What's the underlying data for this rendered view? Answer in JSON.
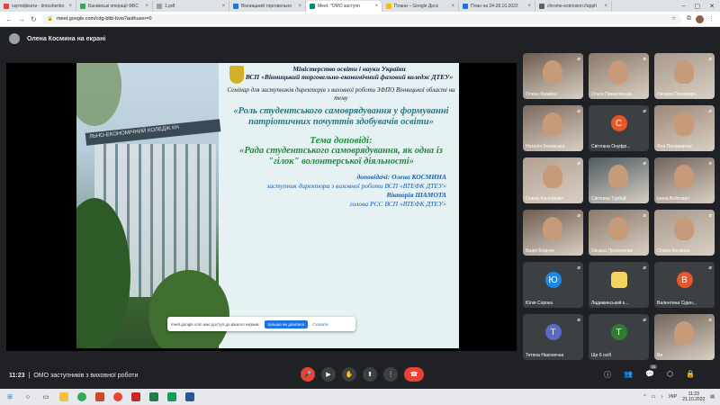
{
  "browser": {
    "tabs": [
      {
        "label": "сертифікати - timoshenko",
        "color": "#ea4335",
        "active": false
      },
      {
        "label": "Банківські операції ФБС",
        "color": "#34a853",
        "active": false
      },
      {
        "label": "1.pdf",
        "color": "#9aa0a6",
        "active": false
      },
      {
        "label": "Вінницький торговельно",
        "color": "#1a73e8",
        "active": false
      },
      {
        "label": "Meet: \"ОМО заступн",
        "color": "#00897b",
        "active": true
      },
      {
        "label": "Плани – Google Диск",
        "color": "#fbbc04",
        "active": false
      },
      {
        "label": "План на 24-28.10.2022",
        "color": "#1a73e8",
        "active": false
      },
      {
        "label": "chrome-extension://apph",
        "color": "#5f6368",
        "active": false
      }
    ],
    "url": "meet.google.com/cdg-btib-bvw?authuser=0",
    "icons": [
      "back-arrow-icon",
      "forward-arrow-icon",
      "reload-icon",
      "lock-icon",
      "star-icon",
      "extensions-icon",
      "menu-icon"
    ]
  },
  "presenter": {
    "label": "Олена Космина на екрані"
  },
  "slide": {
    "building_sign": "ЛЬНО-ЕКОНОМІЧНИЙ КОЛЕДЖ КН",
    "ministry": "Міністерство освіти і науки України",
    "college": "ВСП «Вінницький торговельно-економічний фаховий коледж ДТЕУ»",
    "seminar": "Семінар для заступників директорів з виховної роботи ЗФПО Вінницької області на тему",
    "role_title": "«Роль студентського самоврядування у формуванні патріотичних почуттів здобувачів освіти»",
    "topic_heading": "Тема доповіді:",
    "topic": "«Рада студентського самоврядування, як одна із \"гілок\" волонтерської діяльності»",
    "speakers_label": "доповідачі: Олена КОСМИНА",
    "speaker1_role": "заступник директора з виховної роботи ВСП «ВТЕФК ДТЕУ»",
    "speaker2_name": "Вікторія ШАМОТА",
    "speaker2_role": "голова РСС ВСП «ВТЕФК ДТЕУ»"
  },
  "share_notice": {
    "text": "meet.google.com має доступ до вашого екрана.",
    "stop_button": "Більше не ділитися",
    "hide_button": "Сховати"
  },
  "participants": [
    {
      "name": "Олена Кваміна",
      "type": "video"
    },
    {
      "name": "Ольга Пиньковська",
      "type": "video"
    },
    {
      "name": "Наталія Паламарч...",
      "type": "video"
    },
    {
      "name": "Наталія Возовська",
      "type": "video"
    },
    {
      "name": "Світлана Онуфрі...",
      "type": "letter",
      "letter": "С",
      "color": "#e8572a"
    },
    {
      "name": "Яна Паламарчук",
      "type": "video"
    },
    {
      "name": "Олена Косперевіч",
      "type": "video"
    },
    {
      "name": "Світлана Турбай",
      "type": "video"
    },
    {
      "name": "Ірина Войтович",
      "type": "video"
    },
    {
      "name": "Вадія Блідчук",
      "type": "video"
    },
    {
      "name": "Оксана Прокопенко",
      "type": "video"
    },
    {
      "name": "Олена Космина",
      "type": "video"
    },
    {
      "name": "Юлія Сорока",
      "type": "letter",
      "letter": "Ю",
      "color": "#1e88e5"
    },
    {
      "name": "Ладижинський к...",
      "type": "logo"
    },
    {
      "name": "Валентина Сіден...",
      "type": "letter",
      "letter": "В",
      "color": "#e8572a"
    },
    {
      "name": "Тетяна Наконечна",
      "type": "letter",
      "letter": "Т",
      "color": "#5c6bc0"
    },
    {
      "name": "Ще 6 осіб",
      "type": "more",
      "letter": "Т",
      "color": "#2e7d32"
    },
    {
      "name": "Ви",
      "type": "video"
    }
  ],
  "bottom": {
    "time": "11:23",
    "separator": "|",
    "meeting_title": "ОМО заступників з виховної роботи",
    "badge_count": "24"
  },
  "taskbar": {
    "lang": "УКР",
    "clock_time": "11:23",
    "clock_date": "21.10.2022"
  }
}
